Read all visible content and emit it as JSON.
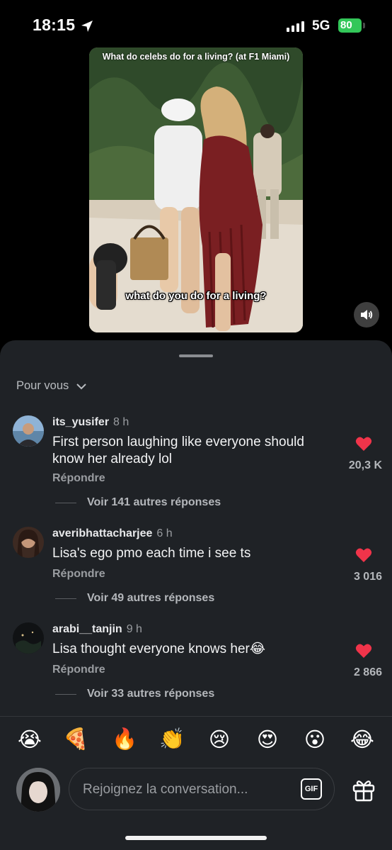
{
  "status": {
    "time": "18:15",
    "network": "5G",
    "battery": "80"
  },
  "video": {
    "title": "What do celebs do for a living? (at F1 Miami)",
    "caption": "what do you do for a living?"
  },
  "sheet": {
    "sort_label": "Pour vous"
  },
  "comments": [
    {
      "username": "its_yusifer",
      "age": "8 h",
      "text": "First person laughing like everyone should know her already lol",
      "reply_label": "Répondre",
      "replies_label": "Voir 141 autres réponses",
      "likes": "20,3 K"
    },
    {
      "username": "averibhattacharjee",
      "age": "6 h",
      "text": "Lisa's ego pmo each time i see ts",
      "reply_label": "Répondre",
      "replies_label": "Voir 49 autres réponses",
      "likes": "3 016"
    },
    {
      "username": "arabi__tanjin",
      "age": "9 h",
      "text": "Lisa thought everyone knows her😂",
      "reply_label": "Répondre",
      "replies_label": "Voir 33 autres réponses",
      "likes": "2 866"
    }
  ],
  "emojis": [
    "😭",
    "🍕",
    "🔥",
    "👏",
    "😢",
    "😍",
    "😮",
    "😂"
  ],
  "composer": {
    "placeholder": "Rejoignez la conversation...",
    "gif_label": "GIF"
  },
  "colors": {
    "heart": "#f0344a",
    "battery": "#33c759",
    "sheet": "#1f2226"
  }
}
